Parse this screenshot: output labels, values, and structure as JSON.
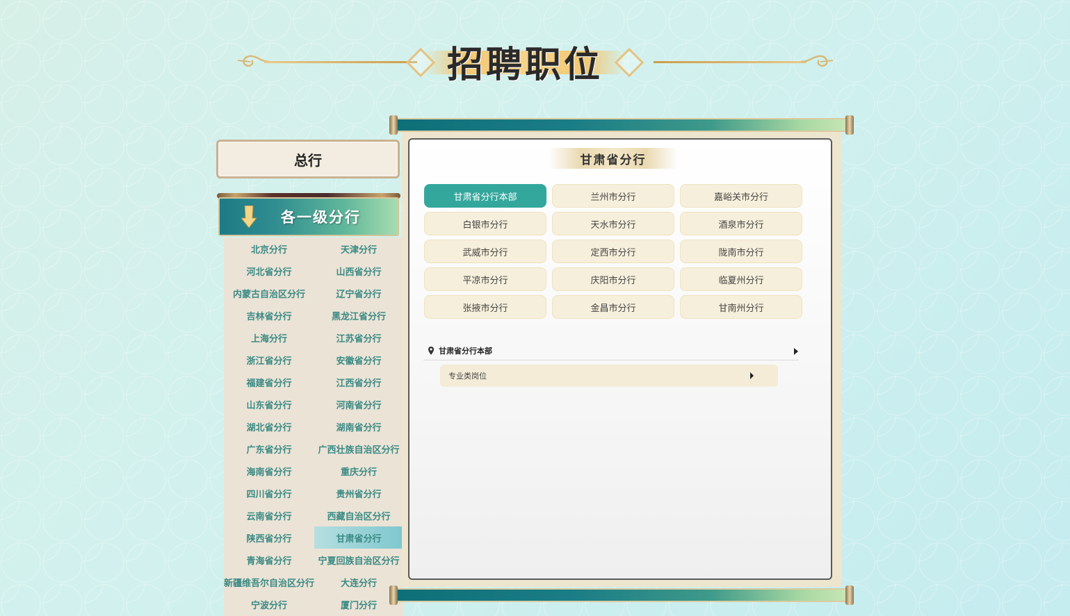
{
  "page_title": "招聘职位",
  "headquarters_label": "总行",
  "branches_header": "各一级分行",
  "branches": [
    {
      "label": "北京分行"
    },
    {
      "label": "天津分行"
    },
    {
      "label": "河北省分行"
    },
    {
      "label": "山西省分行"
    },
    {
      "label": "内蒙古自治区分行"
    },
    {
      "label": "辽宁省分行"
    },
    {
      "label": "吉林省分行"
    },
    {
      "label": "黑龙江省分行"
    },
    {
      "label": "上海分行"
    },
    {
      "label": "江苏省分行"
    },
    {
      "label": "浙江省分行"
    },
    {
      "label": "安徽省分行"
    },
    {
      "label": "福建省分行"
    },
    {
      "label": "江西省分行"
    },
    {
      "label": "山东省分行"
    },
    {
      "label": "河南省分行"
    },
    {
      "label": "湖北省分行"
    },
    {
      "label": "湖南省分行"
    },
    {
      "label": "广东省分行"
    },
    {
      "label": "广西壮族自治区分行"
    },
    {
      "label": "海南省分行"
    },
    {
      "label": "重庆分行"
    },
    {
      "label": "四川省分行"
    },
    {
      "label": "贵州省分行"
    },
    {
      "label": "云南省分行"
    },
    {
      "label": "西藏自治区分行"
    },
    {
      "label": "陕西省分行"
    },
    {
      "label": "甘肃省分行",
      "active": true
    },
    {
      "label": "青海省分行"
    },
    {
      "label": "宁夏回族自治区分行"
    },
    {
      "label": "新疆维吾尔自治区分行"
    },
    {
      "label": "大连分行"
    },
    {
      "label": "宁波分行"
    },
    {
      "label": "厦门分行"
    }
  ],
  "panel": {
    "title": "甘肃省分行",
    "cities": [
      {
        "label": "甘肃省分行本部",
        "active": true
      },
      {
        "label": "兰州市分行"
      },
      {
        "label": "嘉峪关市分行"
      },
      {
        "label": "白银市分行"
      },
      {
        "label": "天水市分行"
      },
      {
        "label": "酒泉市分行"
      },
      {
        "label": "武威市分行"
      },
      {
        "label": "定西市分行"
      },
      {
        "label": "陇南市分行"
      },
      {
        "label": "平凉市分行"
      },
      {
        "label": "庆阳市分行"
      },
      {
        "label": "临夏州分行"
      },
      {
        "label": "张掖市分行"
      },
      {
        "label": "金昌市分行"
      },
      {
        "label": "甘南州分行"
      }
    ],
    "location_label": "甘肃省分行本部",
    "job_category": "专业类岗位"
  },
  "colors": {
    "accent_teal": "#34a79d",
    "branch_text": "#3a8a84",
    "button_bg": "#f6efdb"
  }
}
